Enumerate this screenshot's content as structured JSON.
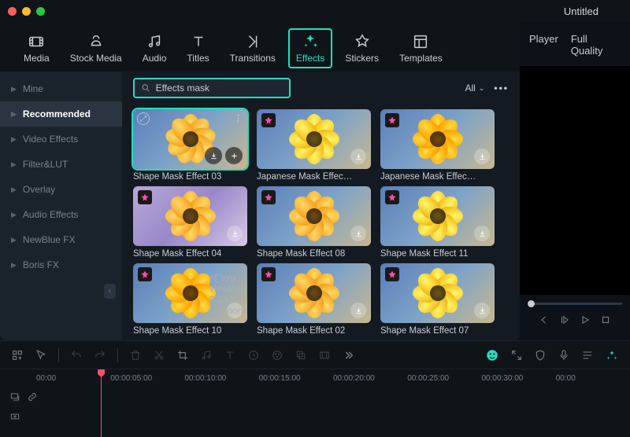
{
  "doc_title": "Untitled",
  "tabs": {
    "media": "Media",
    "stock": "Stock Media",
    "audio": "Audio",
    "titles": "Titles",
    "transitions": "Transitions",
    "effects": "Effects",
    "stickers": "Stickers",
    "templates": "Templates"
  },
  "search": {
    "value": "Effects mask"
  },
  "filter": {
    "label": "All"
  },
  "sidebar": {
    "items": [
      "Mine",
      "Recommended",
      "Video Effects",
      "Filter&LUT",
      "Overlay",
      "Audio Effects",
      "NewBlue FX",
      "Boris FX"
    ]
  },
  "grid": {
    "r1": [
      "Shape Mask Effect 03",
      "Japanese Mask Effec…",
      "Japanese Mask Effec…"
    ],
    "r2": [
      "Shape Mask Effect 04",
      "Shape Mask Effect 08",
      "Shape Mask Effect 11"
    ],
    "r3": [
      "Shape Mask Effect 10",
      "Shape Mask Effect 02",
      "Shape Mask Effect 07"
    ]
  },
  "player": {
    "tab1": "Player",
    "tab2": "Full Quality"
  },
  "timeline": {
    "stamps": [
      "00:00",
      "00:00:05:00",
      "00:00:10:00",
      "00:00:15:00",
      "00:00:20:00",
      "00:00:25:00",
      "00:00:30:00",
      "00:00"
    ]
  }
}
